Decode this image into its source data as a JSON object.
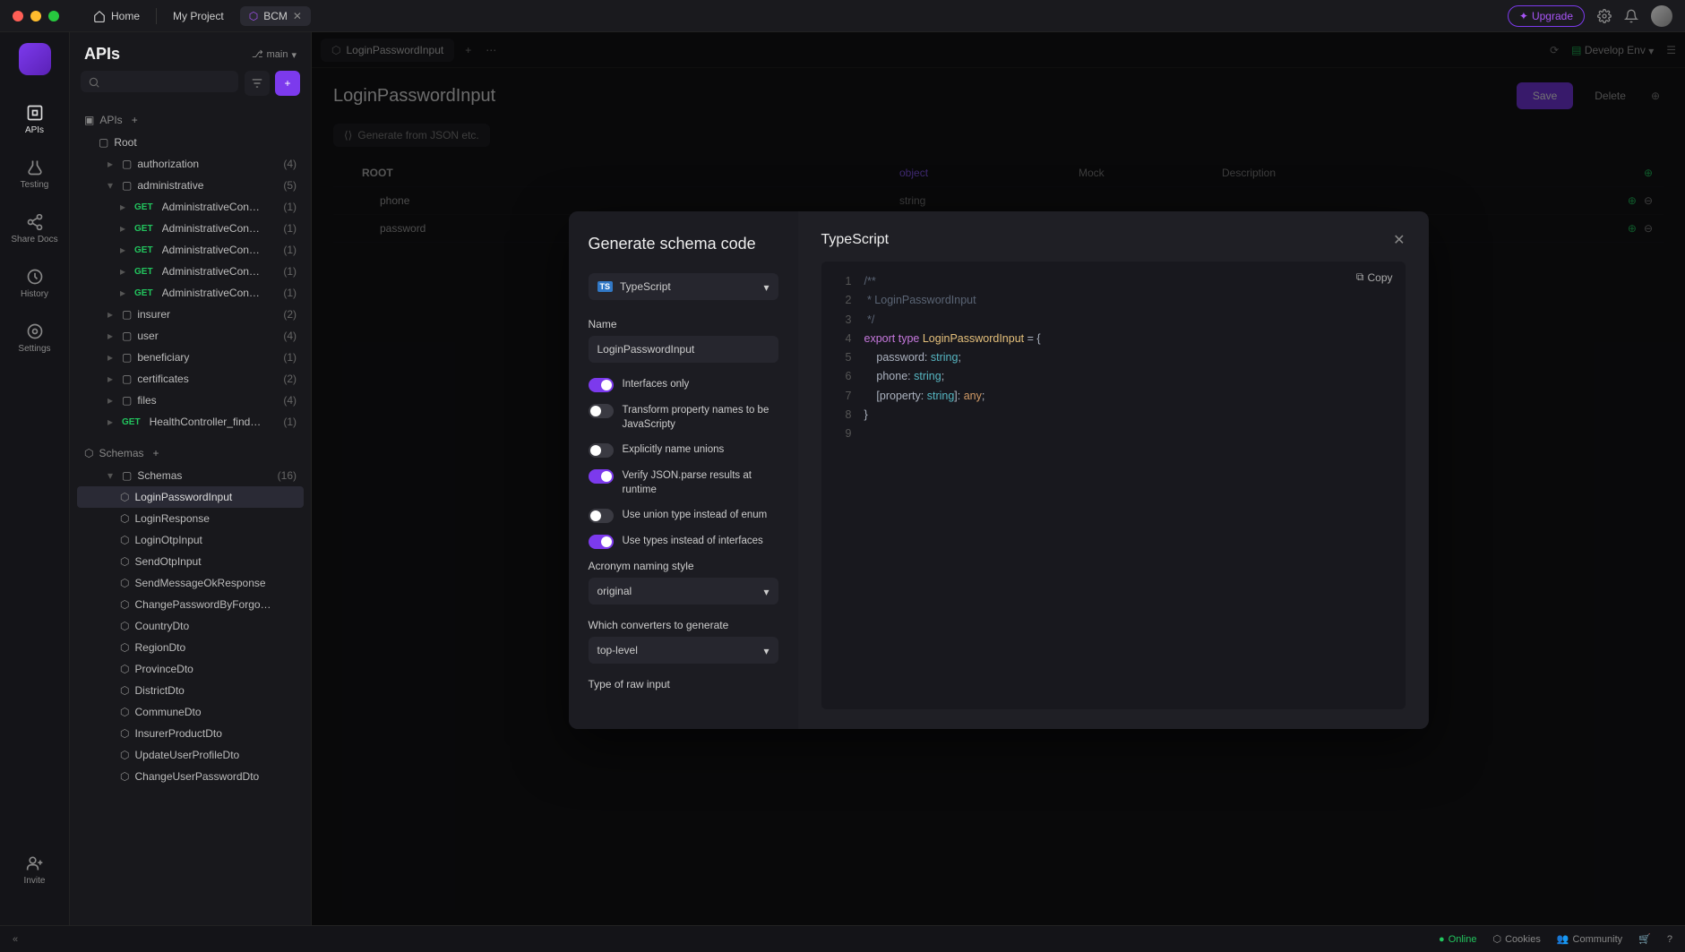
{
  "titlebar": {
    "home": "Home",
    "project": "My Project",
    "tab_name": "BCM",
    "upgrade": "Upgrade"
  },
  "rail": {
    "apis": "APIs",
    "testing": "Testing",
    "share": "Share Docs",
    "history": "History",
    "settings": "Settings",
    "invite": "Invite"
  },
  "sidebar": {
    "heading": "APIs",
    "branch": "main",
    "apis_section": "APIs",
    "root": "Root",
    "folders": [
      {
        "name": "authorization",
        "count": "(4)"
      },
      {
        "name": "administrative",
        "count": "(5)",
        "expanded": true,
        "items": [
          {
            "method": "GET",
            "name": "AdministrativeCon…",
            "count": "(1)"
          },
          {
            "method": "GET",
            "name": "AdministrativeCon…",
            "count": "(1)"
          },
          {
            "method": "GET",
            "name": "AdministrativeCon…",
            "count": "(1)"
          },
          {
            "method": "GET",
            "name": "AdministrativeCon…",
            "count": "(1)"
          },
          {
            "method": "GET",
            "name": "AdministrativeCon…",
            "count": "(1)"
          }
        ]
      },
      {
        "name": "insurer",
        "count": "(2)"
      },
      {
        "name": "user",
        "count": "(4)"
      },
      {
        "name": "beneficiary",
        "count": "(1)"
      },
      {
        "name": "certificates",
        "count": "(2)"
      },
      {
        "name": "files",
        "count": "(4)"
      }
    ],
    "loose_endpoint": {
      "method": "GET",
      "name": "HealthController_find…",
      "count": "(1)"
    },
    "schemas_section": "Schemas",
    "schemas_folder": "Schemas",
    "schemas_count": "(16)",
    "schemas": [
      "LoginPasswordInput",
      "LoginResponse",
      "LoginOtpInput",
      "SendOtpInput",
      "SendMessageOkResponse",
      "ChangePasswordByForgo…",
      "CountryDto",
      "RegionDto",
      "ProvinceDto",
      "DistrictDto",
      "CommuneDto",
      "InsurerProductDto",
      "UpdateUserProfileDto",
      "ChangeUserPasswordDto"
    ]
  },
  "editor": {
    "tab_name": "LoginPasswordInput",
    "env": "Develop Env",
    "title": "LoginPasswordInput",
    "save": "Save",
    "delete": "Delete",
    "generate_json": "Generate from JSON etc.",
    "columns": {
      "mock": "Mock",
      "desc": "Description"
    },
    "root_row": {
      "name": "ROOT",
      "type": "object"
    },
    "rows": [
      {
        "name": "phone",
        "type": "string"
      },
      {
        "name": "password",
        "type": "string"
      }
    ]
  },
  "modal": {
    "title": "Generate schema code",
    "language": "TypeScript",
    "name_label": "Name",
    "name_value": "LoginPasswordInput",
    "toggles": [
      {
        "label": "Interfaces only",
        "on": true
      },
      {
        "label": "Transform property names to be JavaScripty",
        "on": false
      },
      {
        "label": "Explicitly name unions",
        "on": false
      },
      {
        "label": "Verify JSON.parse results at runtime",
        "on": true
      },
      {
        "label": "Use union type instead of enum",
        "on": false
      },
      {
        "label": "Use types instead of interfaces",
        "on": true
      }
    ],
    "acronym_label": "Acronym naming style",
    "acronym_value": "original",
    "converters_label": "Which converters to generate",
    "converters_value": "top-level",
    "raw_label": "Type of raw input",
    "copy": "Copy",
    "code_lines": [
      {
        "raw": "/**",
        "cls": "com"
      },
      {
        "raw": " * LoginPasswordInput",
        "cls": "com"
      },
      {
        "raw": " */",
        "cls": "com"
      },
      {
        "raw": "export type LoginPasswordInput = {"
      },
      {
        "raw": "    password: string;"
      },
      {
        "raw": "    phone: string;"
      },
      {
        "raw": "    [property: string]: any;"
      },
      {
        "raw": "}"
      },
      {
        "raw": ""
      }
    ]
  },
  "footer": {
    "online": "Online",
    "cookies": "Cookies",
    "community": "Community"
  }
}
